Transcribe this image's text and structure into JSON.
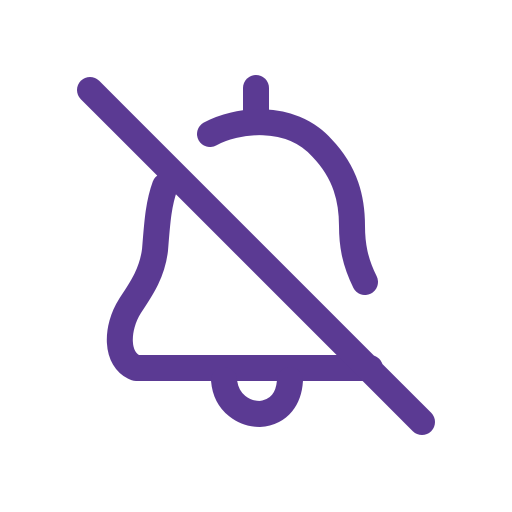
{
  "icon": {
    "name": "bell-off-icon",
    "color": "#5B3A93",
    "background": "#FFFFFF"
  }
}
